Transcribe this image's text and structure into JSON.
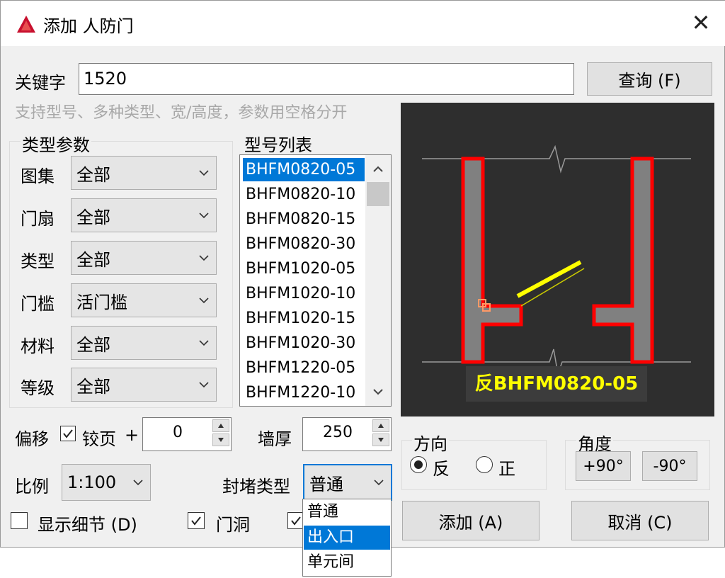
{
  "window": {
    "title": "添加 人防门",
    "close_glyph": "✕"
  },
  "search": {
    "keyword_label": "关键字",
    "keyword_value": "1520",
    "query_button": "查询 (F)",
    "hint": "支持型号、多种类型、宽/高度，参数用空格分开"
  },
  "type_params": {
    "title": "类型参数",
    "rows": [
      {
        "label": "图集",
        "value": "全部"
      },
      {
        "label": "门扇",
        "value": "全部"
      },
      {
        "label": "类型",
        "value": "全部"
      },
      {
        "label": "门槛",
        "value": "活门槛"
      },
      {
        "label": "材料",
        "value": "全部"
      },
      {
        "label": "等级",
        "value": "全部"
      }
    ]
  },
  "model_list": {
    "title": "型号列表",
    "items": [
      "BHFM0820-05",
      "BHFM0820-10",
      "BHFM0820-15",
      "BHFM0820-30",
      "BHFM1020-05",
      "BHFM1020-10",
      "BHFM1020-15",
      "BHFM1020-30",
      "BHFM1220-05",
      "BHFM1220-10"
    ],
    "selected_index": 0
  },
  "preview": {
    "caption": "反BHFM0820-05",
    "colors": {
      "wall": "#808080",
      "outline": "#ff0000",
      "door": "#ffff00",
      "background": "#2e2e2e"
    }
  },
  "offset": {
    "label": "偏移",
    "hinge_label": "铰页",
    "hinge_checked": true,
    "plus": "+",
    "value": "0"
  },
  "wall": {
    "label": "墙厚",
    "value": "250"
  },
  "scale": {
    "label": "比例",
    "value": "1:100"
  },
  "seal": {
    "label": "封堵类型",
    "value": "普通",
    "options": [
      "普通",
      "出入口",
      "单元间"
    ],
    "highlighted_index": 1
  },
  "direction": {
    "title": "方向",
    "options": [
      "反",
      "正"
    ],
    "selected": "反"
  },
  "angle": {
    "title": "角度",
    "plus": "+90°",
    "minus": "-90°"
  },
  "checks": {
    "show_detail": {
      "label": "显示细节 (D)",
      "checked": false
    },
    "door_opening": {
      "label": "门洞",
      "checked": true
    },
    "third_checked": true
  },
  "buttons": {
    "add": "添加 (A)",
    "cancel": "取消 (C)"
  }
}
